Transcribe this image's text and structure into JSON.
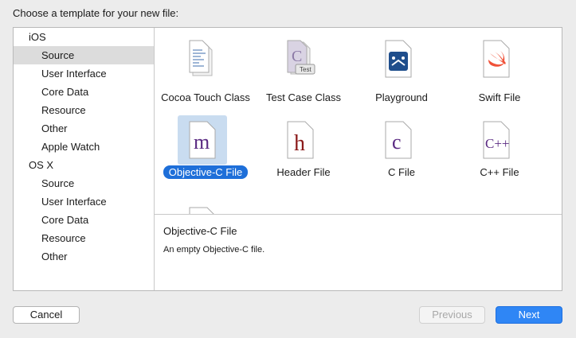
{
  "prompt": "Choose a template for your new file:",
  "sidebar": {
    "groups": [
      {
        "label": "iOS",
        "items": [
          "Source",
          "User Interface",
          "Core Data",
          "Resource",
          "Other",
          "Apple Watch"
        ]
      },
      {
        "label": "OS X",
        "items": [
          "Source",
          "User Interface",
          "Core Data",
          "Resource",
          "Other"
        ]
      }
    ],
    "selected": "iOS/Source"
  },
  "templates": [
    {
      "label": "Cocoa Touch Class",
      "icon": "cocoa-touch-class-icon"
    },
    {
      "label": "Test Case Class",
      "icon": "test-case-class-icon",
      "badge": "Test",
      "glyph": "C"
    },
    {
      "label": "Playground",
      "icon": "playground-icon"
    },
    {
      "label": "Swift File",
      "icon": "swift-icon"
    },
    {
      "label": "Objective-C File",
      "icon": "objective-c-file-icon",
      "glyph": "m",
      "selected": true
    },
    {
      "label": "Header File",
      "icon": "header-file-icon",
      "glyph": "h"
    },
    {
      "label": "C File",
      "icon": "c-file-icon",
      "glyph": "c"
    },
    {
      "label": "C++ File",
      "icon": "cpp-file-icon",
      "glyph": "C++"
    }
  ],
  "description": {
    "title": "Objective-C File",
    "text": "An empty Objective-C file."
  },
  "buttons": {
    "cancel": "Cancel",
    "previous": "Previous",
    "next": "Next"
  },
  "colors": {
    "selection": "#1e6fd9",
    "next_button": "#2f86f5",
    "objc_glyph": "#5a2a82",
    "header_glyph": "#8b1a1a",
    "swift": "#f05138"
  }
}
